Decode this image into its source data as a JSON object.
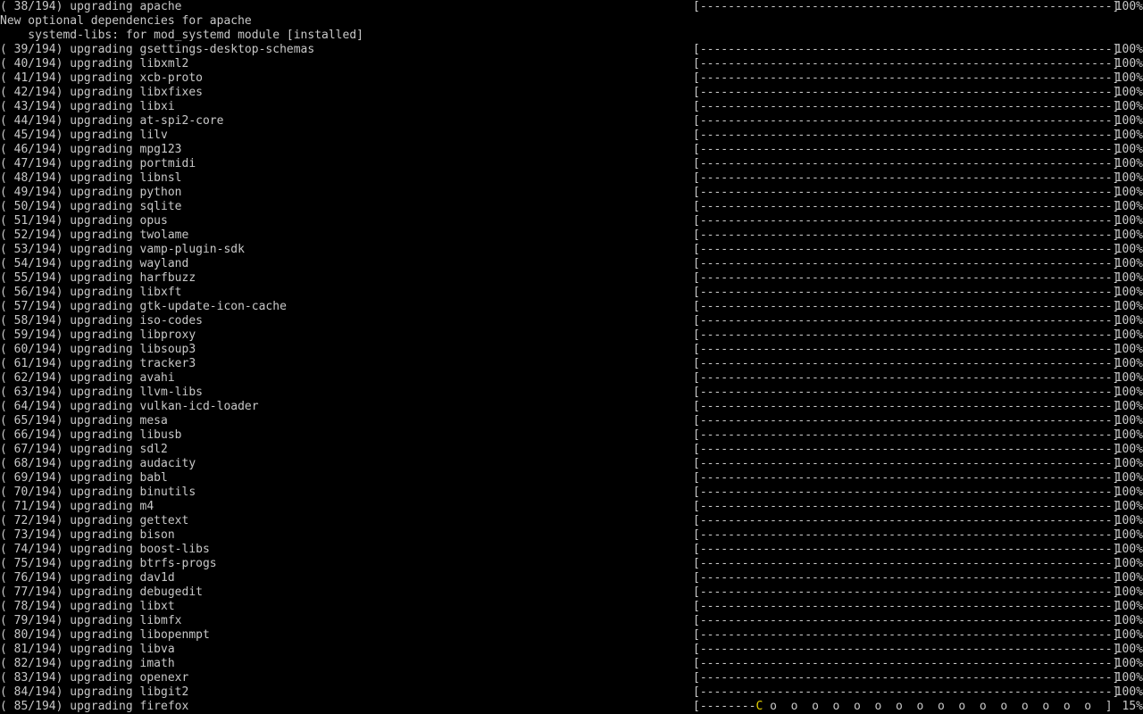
{
  "terminal": {
    "lines": [
      {
        "kind": "progress",
        "message": "( 38/194) upgrading apache",
        "bar": "[-----------------------------------------------------------]",
        "percent": "100%"
      },
      {
        "kind": "text",
        "text": "New optional dependencies for apache"
      },
      {
        "kind": "text",
        "text": "    systemd-libs: for mod_systemd module [installed]"
      },
      {
        "kind": "progress",
        "message": "( 39/194) upgrading gsettings-desktop-schemas",
        "bar": "[-----------------------------------------------------------]",
        "percent": "100%"
      },
      {
        "kind": "progress",
        "message": "( 40/194) upgrading libxml2",
        "bar": "[-----------------------------------------------------------]",
        "percent": "100%"
      },
      {
        "kind": "progress",
        "message": "( 41/194) upgrading xcb-proto",
        "bar": "[-----------------------------------------------------------]",
        "percent": "100%"
      },
      {
        "kind": "progress",
        "message": "( 42/194) upgrading libxfixes",
        "bar": "[-----------------------------------------------------------]",
        "percent": "100%"
      },
      {
        "kind": "progress",
        "message": "( 43/194) upgrading libxi",
        "bar": "[-----------------------------------------------------------]",
        "percent": "100%"
      },
      {
        "kind": "progress",
        "message": "( 44/194) upgrading at-spi2-core",
        "bar": "[-----------------------------------------------------------]",
        "percent": "100%"
      },
      {
        "kind": "progress",
        "message": "( 45/194) upgrading lilv",
        "bar": "[-----------------------------------------------------------]",
        "percent": "100%"
      },
      {
        "kind": "progress",
        "message": "( 46/194) upgrading mpg123",
        "bar": "[-----------------------------------------------------------]",
        "percent": "100%"
      },
      {
        "kind": "progress",
        "message": "( 47/194) upgrading portmidi",
        "bar": "[-----------------------------------------------------------]",
        "percent": "100%"
      },
      {
        "kind": "progress",
        "message": "( 48/194) upgrading libnsl",
        "bar": "[-----------------------------------------------------------]",
        "percent": "100%"
      },
      {
        "kind": "progress",
        "message": "( 49/194) upgrading python",
        "bar": "[-----------------------------------------------------------]",
        "percent": "100%"
      },
      {
        "kind": "progress",
        "message": "( 50/194) upgrading sqlite",
        "bar": "[-----------------------------------------------------------]",
        "percent": "100%"
      },
      {
        "kind": "progress",
        "message": "( 51/194) upgrading opus",
        "bar": "[-----------------------------------------------------------]",
        "percent": "100%"
      },
      {
        "kind": "progress",
        "message": "( 52/194) upgrading twolame",
        "bar": "[-----------------------------------------------------------]",
        "percent": "100%"
      },
      {
        "kind": "progress",
        "message": "( 53/194) upgrading vamp-plugin-sdk",
        "bar": "[-----------------------------------------------------------]",
        "percent": "100%"
      },
      {
        "kind": "progress",
        "message": "( 54/194) upgrading wayland",
        "bar": "[-----------------------------------------------------------]",
        "percent": "100%"
      },
      {
        "kind": "progress",
        "message": "( 55/194) upgrading harfbuzz",
        "bar": "[-----------------------------------------------------------]",
        "percent": "100%"
      },
      {
        "kind": "progress",
        "message": "( 56/194) upgrading libxft",
        "bar": "[-----------------------------------------------------------]",
        "percent": "100%"
      },
      {
        "kind": "progress",
        "message": "( 57/194) upgrading gtk-update-icon-cache",
        "bar": "[-----------------------------------------------------------]",
        "percent": "100%"
      },
      {
        "kind": "progress",
        "message": "( 58/194) upgrading iso-codes",
        "bar": "[-----------------------------------------------------------]",
        "percent": "100%"
      },
      {
        "kind": "progress",
        "message": "( 59/194) upgrading libproxy",
        "bar": "[-----------------------------------------------------------]",
        "percent": "100%"
      },
      {
        "kind": "progress",
        "message": "( 60/194) upgrading libsoup3",
        "bar": "[-----------------------------------------------------------]",
        "percent": "100%"
      },
      {
        "kind": "progress",
        "message": "( 61/194) upgrading tracker3",
        "bar": "[-----------------------------------------------------------]",
        "percent": "100%"
      },
      {
        "kind": "progress",
        "message": "( 62/194) upgrading avahi",
        "bar": "[-----------------------------------------------------------]",
        "percent": "100%"
      },
      {
        "kind": "progress",
        "message": "( 63/194) upgrading llvm-libs",
        "bar": "[-----------------------------------------------------------]",
        "percent": "100%"
      },
      {
        "kind": "progress",
        "message": "( 64/194) upgrading vulkan-icd-loader",
        "bar": "[-----------------------------------------------------------]",
        "percent": "100%"
      },
      {
        "kind": "progress",
        "message": "( 65/194) upgrading mesa",
        "bar": "[-----------------------------------------------------------]",
        "percent": "100%"
      },
      {
        "kind": "progress",
        "message": "( 66/194) upgrading libusb",
        "bar": "[-----------------------------------------------------------]",
        "percent": "100%"
      },
      {
        "kind": "progress",
        "message": "( 67/194) upgrading sdl2",
        "bar": "[-----------------------------------------------------------]",
        "percent": "100%"
      },
      {
        "kind": "progress",
        "message": "( 68/194) upgrading audacity",
        "bar": "[-----------------------------------------------------------]",
        "percent": "100%"
      },
      {
        "kind": "progress",
        "message": "( 69/194) upgrading babl",
        "bar": "[-----------------------------------------------------------]",
        "percent": "100%"
      },
      {
        "kind": "progress",
        "message": "( 70/194) upgrading binutils",
        "bar": "[-----------------------------------------------------------]",
        "percent": "100%"
      },
      {
        "kind": "progress",
        "message": "( 71/194) upgrading m4",
        "bar": "[-----------------------------------------------------------]",
        "percent": "100%"
      },
      {
        "kind": "progress",
        "message": "( 72/194) upgrading gettext",
        "bar": "[-----------------------------------------------------------]",
        "percent": "100%"
      },
      {
        "kind": "progress",
        "message": "( 73/194) upgrading bison",
        "bar": "[-----------------------------------------------------------]",
        "percent": "100%"
      },
      {
        "kind": "progress",
        "message": "( 74/194) upgrading boost-libs",
        "bar": "[-----------------------------------------------------------]",
        "percent": "100%"
      },
      {
        "kind": "progress",
        "message": "( 75/194) upgrading btrfs-progs",
        "bar": "[-----------------------------------------------------------]",
        "percent": "100%"
      },
      {
        "kind": "progress",
        "message": "( 76/194) upgrading dav1d",
        "bar": "[-----------------------------------------------------------]",
        "percent": "100%"
      },
      {
        "kind": "progress",
        "message": "( 77/194) upgrading debugedit",
        "bar": "[-----------------------------------------------------------]",
        "percent": "100%"
      },
      {
        "kind": "progress",
        "message": "( 78/194) upgrading libxt",
        "bar": "[-----------------------------------------------------------]",
        "percent": "100%"
      },
      {
        "kind": "progress",
        "message": "( 79/194) upgrading libmfx",
        "bar": "[-----------------------------------------------------------]",
        "percent": "100%"
      },
      {
        "kind": "progress",
        "message": "( 80/194) upgrading libopenmpt",
        "bar": "[-----------------------------------------------------------]",
        "percent": "100%"
      },
      {
        "kind": "progress",
        "message": "( 81/194) upgrading libva",
        "bar": "[-----------------------------------------------------------]",
        "percent": "100%"
      },
      {
        "kind": "progress",
        "message": "( 82/194) upgrading imath",
        "bar": "[-----------------------------------------------------------]",
        "percent": "100%"
      },
      {
        "kind": "progress",
        "message": "( 83/194) upgrading openexr",
        "bar": "[-----------------------------------------------------------]",
        "percent": "100%"
      },
      {
        "kind": "progress",
        "message": "( 84/194) upgrading libgit2",
        "bar": "[-----------------------------------------------------------]",
        "percent": "100%"
      },
      {
        "kind": "progress",
        "message": "( 85/194) upgrading firefox",
        "bar_start": "[--------",
        "bar_pacman": "C",
        "bar_end": " o  o  o  o  o  o  o  o  o  o  o  o  o  o  o  o  ]",
        "percent": " 15%"
      }
    ],
    "colors": {
      "background": "#000000",
      "text": "#c8c8c8",
      "pacman": "#e6d200"
    }
  }
}
